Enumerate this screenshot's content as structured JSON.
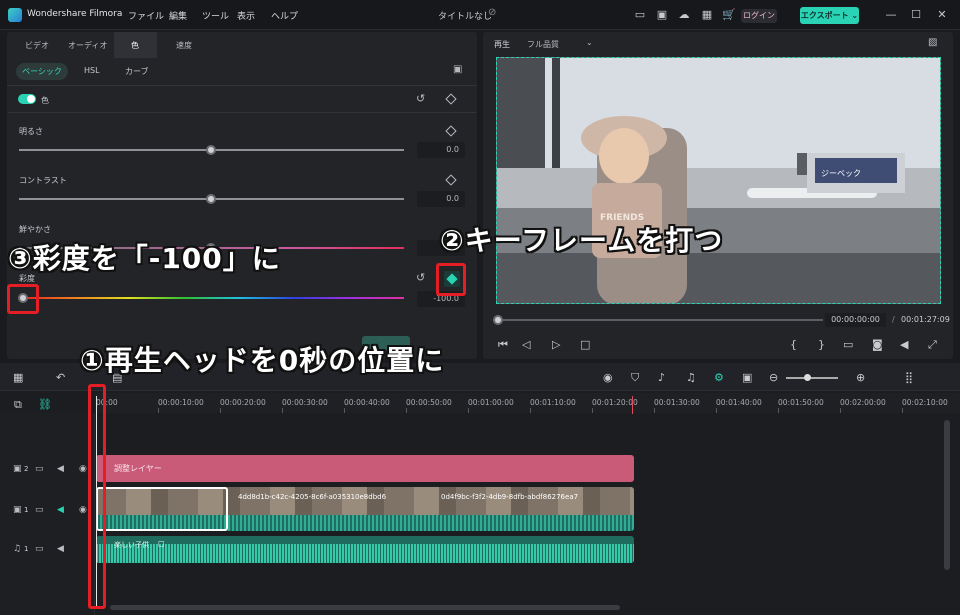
{
  "app": {
    "name": "Wondershare Filmora",
    "doc_title": "タイトルなし"
  },
  "menu": [
    "ファイル",
    "編集",
    "ツール",
    "表示",
    "ヘルプ"
  ],
  "account": {
    "login_label": "ログイン",
    "export_label": "エクスポート ⌄"
  },
  "editor": {
    "tabs": [
      "ビデオ",
      "オーディオ",
      "色",
      "速度"
    ],
    "subtabs": [
      "ベーシック",
      "HSL",
      "カーブ"
    ],
    "color_section": "色",
    "brightness": {
      "label": "明るさ",
      "value": "0.0"
    },
    "contrast": {
      "label": "コントラスト",
      "value": "0.0"
    },
    "vibrance": {
      "label": "鮮やかさ",
      "value": "0.0"
    },
    "saturation": {
      "label": "彩度",
      "value": "-100.0"
    }
  },
  "preview": {
    "label": "再生",
    "quality": "フル品質",
    "current_time": "00:00:00:00",
    "separator": "/",
    "total_time": "00:01:27:09",
    "jersey_text": "FRIENDS",
    "billboard_text": "ジーベック"
  },
  "timeline": {
    "ruler": [
      "00:00",
      "00:00:10:00",
      "00:00:20:00",
      "00:00:30:00",
      "00:00:40:00",
      "00:00:50:00",
      "00:01:00:00",
      "00:01:10:00",
      "00:01:20:00",
      "00:01:30:00",
      "00:01:40:00",
      "00:01:50:00",
      "00:02:00:00",
      "00:02:10:00"
    ],
    "tracks": [
      {
        "num": "2"
      },
      {
        "num": "1"
      },
      {
        "num": "1"
      }
    ],
    "adjust_layer": "調整レイヤー",
    "clip1": "4dd8d1b-c42c-4205-8c6f-a035310e8dbd6",
    "clip2": "0d4f9bc-f3f2-4db9-8dfb-abdf86276ea7",
    "audio_clip": "楽しい子供",
    "audio_badge": "◻"
  },
  "annotations": {
    "step1": "①再生ヘッドを0秒の位置に",
    "step2": "②キーフレームを打つ",
    "step3": "③彩度を「-100」に"
  },
  "colors": {
    "accent": "#29d3b4",
    "adjust": "#c95a78",
    "annotation_red": "#e51e26"
  }
}
